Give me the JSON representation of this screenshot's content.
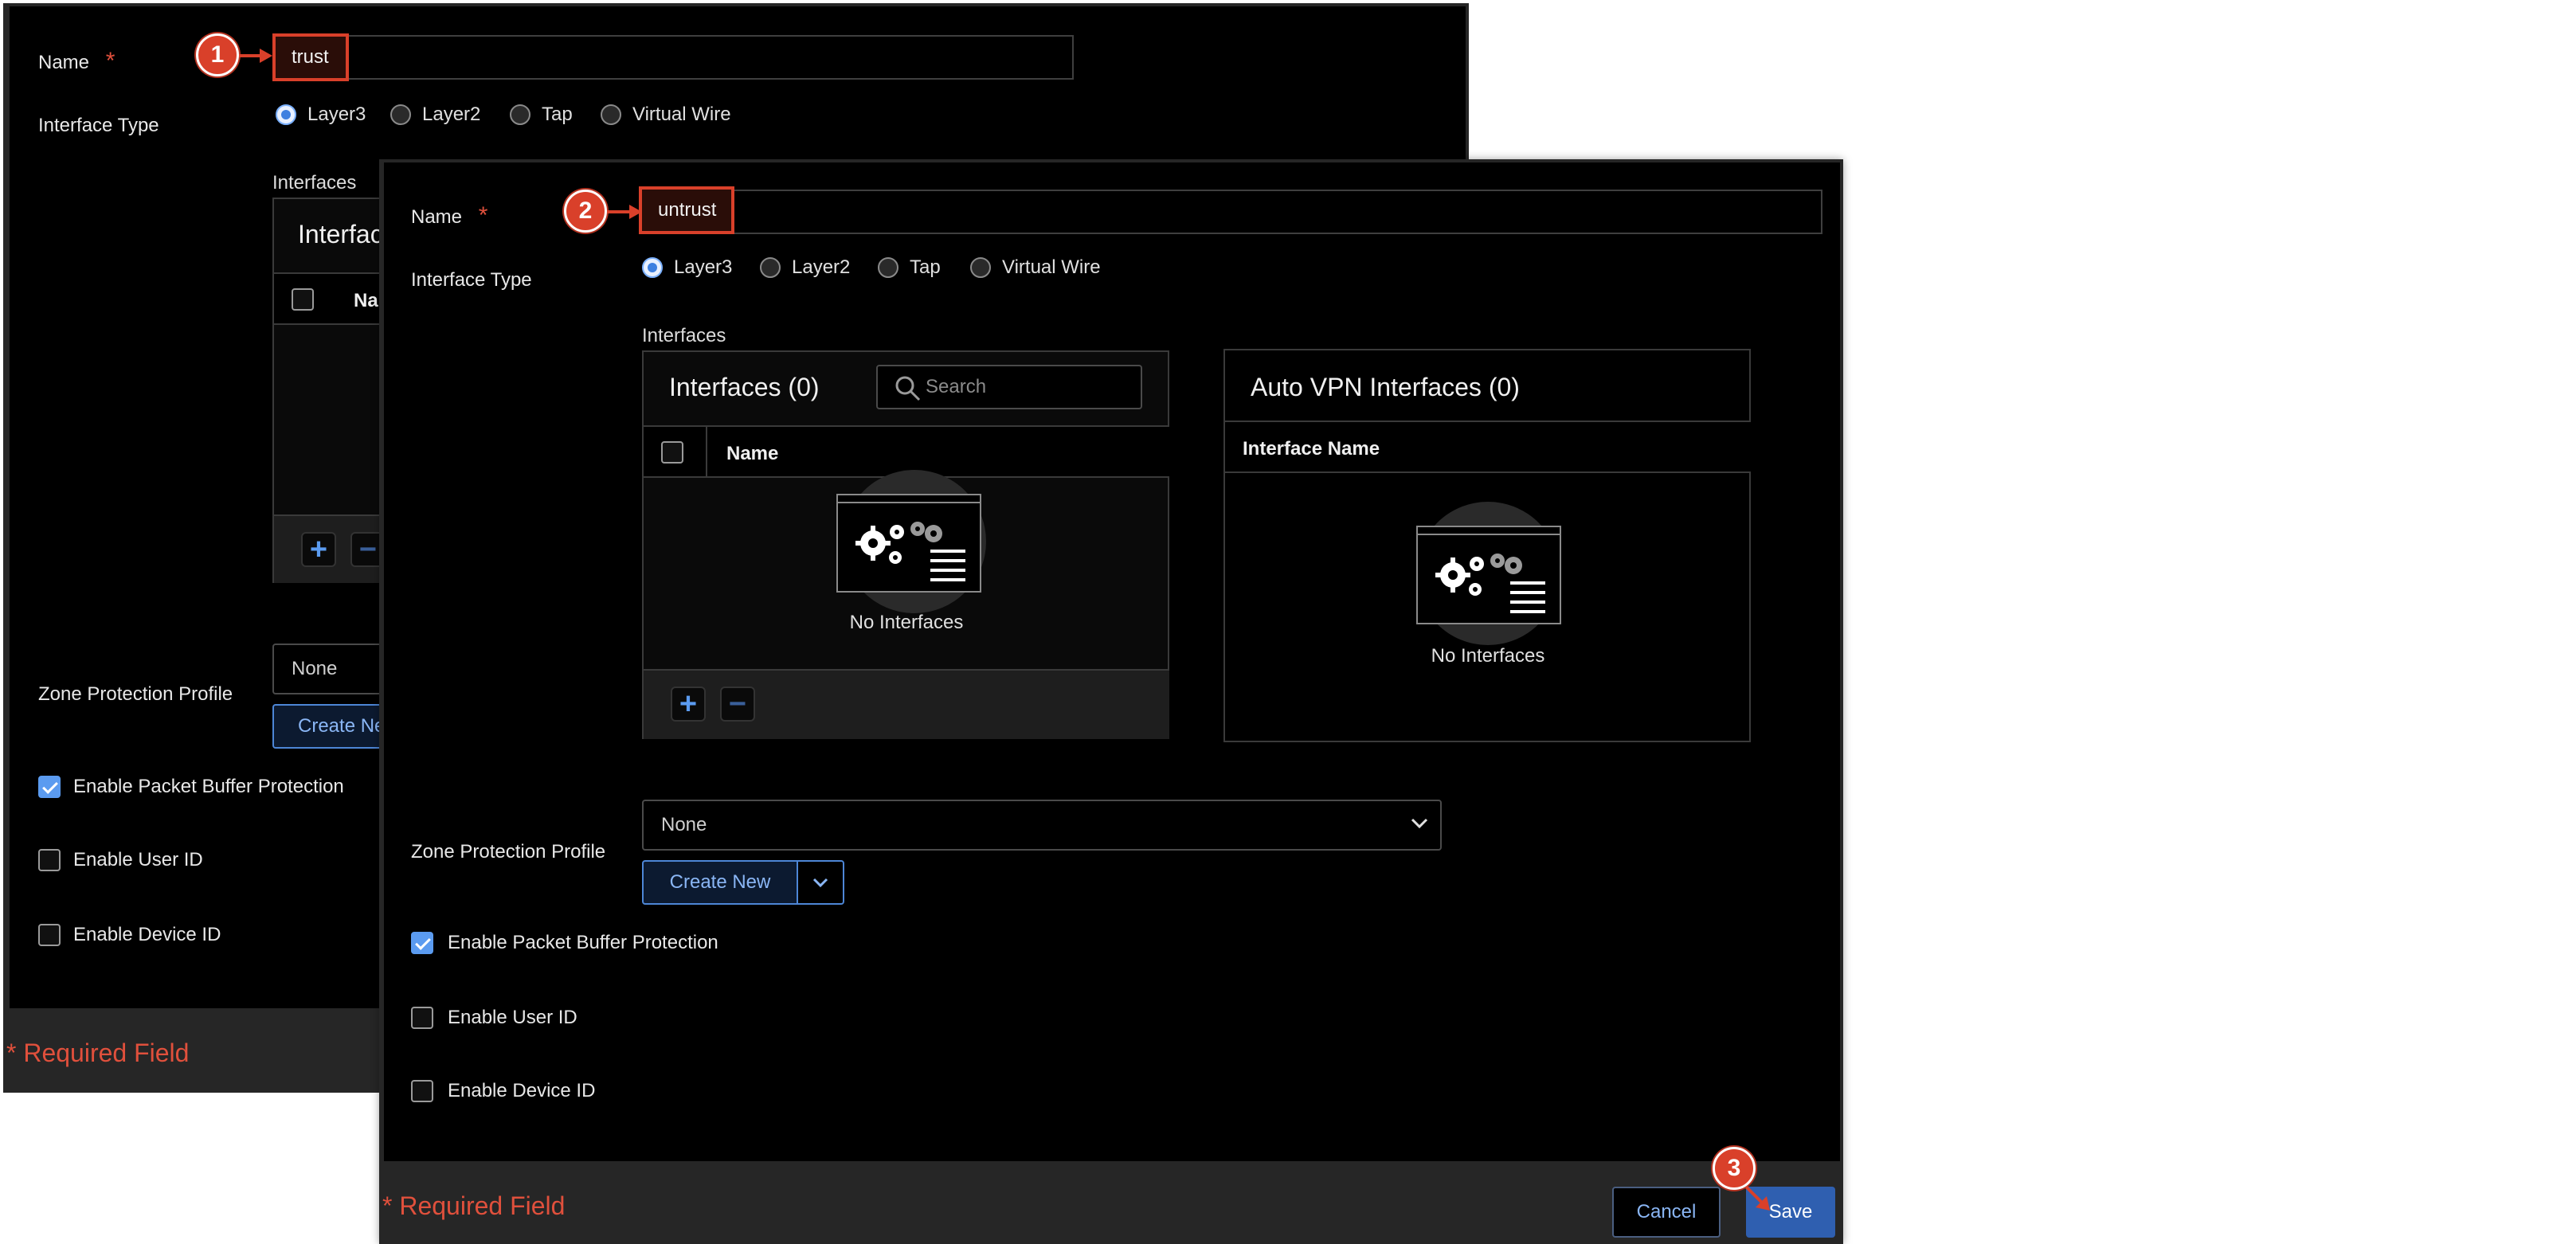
{
  "back_dialog": {
    "name_label": "Name",
    "required_star": "*",
    "name_value": "trust",
    "interface_type_label": "Interface Type",
    "radios": [
      "Layer3",
      "Layer2",
      "Tap",
      "Virtual Wire"
    ],
    "interfaces_label": "Interfaces",
    "interfaces_title_partial": "Interfac",
    "col_name_partial": "Na",
    "zone_label": "Zone Protection Profile",
    "zone_value_partial": "None",
    "create_new_partial": "Create Ne",
    "checkboxes": [
      {
        "label": "Enable Packet Buffer Protection",
        "checked": true
      },
      {
        "label": "Enable User ID",
        "checked": false
      },
      {
        "label": "Enable Device ID",
        "checked": false
      }
    ],
    "required_field": "* Required Field"
  },
  "front_dialog": {
    "name_label": "Name",
    "required_star": "*",
    "name_value": "untrust",
    "interface_type_label": "Interface Type",
    "radios": [
      "Layer3",
      "Layer2",
      "Tap",
      "Virtual Wire"
    ],
    "selected_radio": "Layer3",
    "interfaces_label": "Interfaces",
    "interfaces_box": {
      "title": "Interfaces (0)",
      "search_placeholder": "Search",
      "column": "Name",
      "empty_text": "No Interfaces"
    },
    "auto_vpn_box": {
      "title": "Auto VPN Interfaces (0)",
      "column": "Interface Name",
      "empty_text": "No Interfaces"
    },
    "zone_label": "Zone Protection Profile",
    "zone_value": "None",
    "create_new": "Create New",
    "checkboxes": [
      {
        "label": "Enable Packet Buffer Protection",
        "checked": true
      },
      {
        "label": "Enable User ID",
        "checked": false
      },
      {
        "label": "Enable Device ID",
        "checked": false
      }
    ],
    "required_field": "* Required Field",
    "cancel": "Cancel",
    "save": "Save"
  },
  "callouts": [
    "1",
    "2",
    "3"
  ],
  "colors": {
    "accent": "#5b9bf0",
    "callout": "#d9402a",
    "required": "#e0503c"
  }
}
